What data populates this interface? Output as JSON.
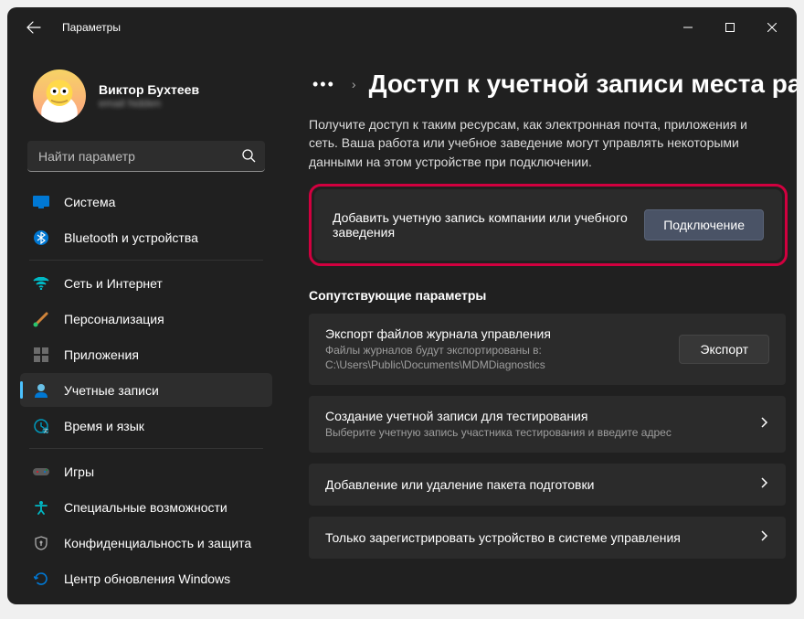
{
  "window": {
    "title": "Параметры"
  },
  "profile": {
    "name": "Виктор Бухтеев",
    "email": "email hidden"
  },
  "search": {
    "placeholder": "Найти параметр"
  },
  "sidebar": {
    "items": [
      {
        "id": "system",
        "label": "Система"
      },
      {
        "id": "bluetooth",
        "label": "Bluetooth и устройства"
      },
      {
        "id": "network",
        "label": "Сеть и Интернет"
      },
      {
        "id": "personalization",
        "label": "Персонализация"
      },
      {
        "id": "apps",
        "label": "Приложения"
      },
      {
        "id": "accounts",
        "label": "Учетные записи"
      },
      {
        "id": "time",
        "label": "Время и язык"
      },
      {
        "id": "games",
        "label": "Игры"
      },
      {
        "id": "accessibility",
        "label": "Специальные возможности"
      },
      {
        "id": "privacy",
        "label": "Конфиденциальность и защита"
      },
      {
        "id": "update",
        "label": "Центр обновления Windows"
      }
    ]
  },
  "breadcrumb": {
    "title": "Доступ к учетной записи места ра"
  },
  "description": "Получите доступ к таким ресурсам, как электронная почта, приложения и сеть. Ваша работа или учебное заведение могут управлять некоторыми данными на этом устройстве при подключении.",
  "connect_card": {
    "title": "Добавить учетную запись компании или учебного заведения",
    "button": "Подключение"
  },
  "related_heading": "Сопутствующие параметры",
  "cards": [
    {
      "title": "Экспорт файлов журнала управления",
      "sub": "Файлы журналов будут экспортированы в: C:\\Users\\Public\\Documents\\MDMDiagnostics",
      "button": "Экспорт"
    },
    {
      "title": "Создание учетной записи для тестирования",
      "sub": "Выберите учетную запись участника тестирования и введите адрес"
    },
    {
      "title": "Добавление или удаление пакета подготовки"
    },
    {
      "title": "Только зарегистрировать устройство в системе управления"
    }
  ]
}
